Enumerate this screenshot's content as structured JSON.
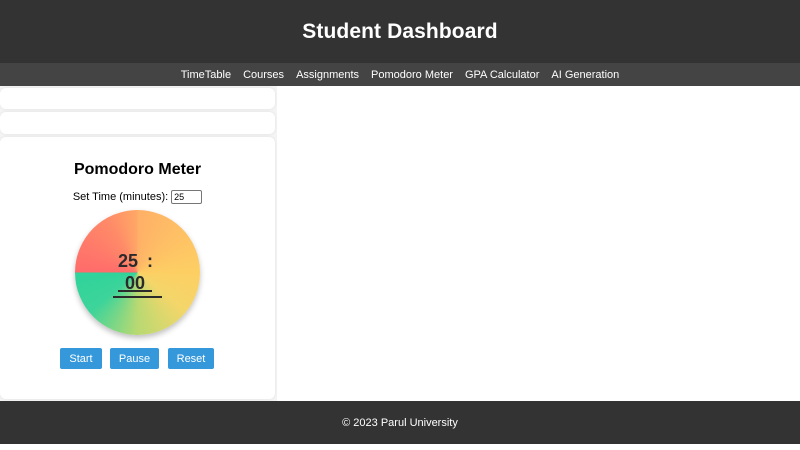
{
  "header": {
    "title": "Student Dashboard"
  },
  "nav": {
    "items": [
      {
        "label": "TimeTable"
      },
      {
        "label": "Courses"
      },
      {
        "label": "Assignments"
      },
      {
        "label": "Pomodoro Meter"
      },
      {
        "label": "GPA Calculator"
      },
      {
        "label": "AI Generation"
      }
    ]
  },
  "pomodoro": {
    "title": "Pomodoro Meter",
    "set_time_label": "Set Time (minutes):",
    "set_time_value": "25",
    "timer": {
      "minutes": "25",
      "colon": ":",
      "seconds": "00"
    },
    "buttons": {
      "start": "Start",
      "pause": "Pause",
      "reset": "Reset"
    }
  },
  "footer": {
    "text": "© 2023 Parul University"
  },
  "colors": {
    "header_bg": "#333333",
    "nav_bg": "#444444",
    "button_bg": "#3498db",
    "dial_red": "#ff6b6b",
    "dial_orange": "#ffb067",
    "dial_yellow": "#fdcf63",
    "dial_green": "#2fd39b"
  }
}
